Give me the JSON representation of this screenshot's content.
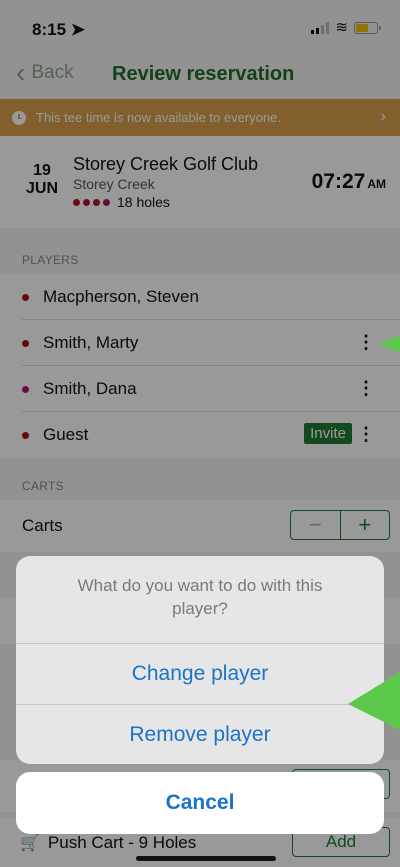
{
  "status_bar": {
    "time": "8:15",
    "location_icon": "location-arrow-icon",
    "signal_icon": "signal-icon",
    "wifi_icon": "wifi-icon",
    "battery_icon": "battery-icon"
  },
  "nav": {
    "back_label": "Back",
    "title": "Review reservation"
  },
  "banner": {
    "text": "This tee time is now available to everyone.",
    "icon": "clock-icon",
    "color": "#d7a04c"
  },
  "course": {
    "day": "19",
    "month": "JUN",
    "club_name": "Storey Creek Golf Club",
    "course_name": "Storey Creek",
    "holes": "18 holes",
    "tee_time": "07:27",
    "ampm": "AM"
  },
  "players": {
    "header": "PLAYERS",
    "items": [
      {
        "name": "Macpherson, Steven"
      },
      {
        "name": "Smith, Marty"
      },
      {
        "name": "Smith, Dana"
      },
      {
        "name": "Guest",
        "badge": "Invite"
      }
    ]
  },
  "carts": {
    "header": "CARTS",
    "label": "Carts",
    "minus": "−",
    "plus": "+"
  },
  "push_cart": {
    "label": "Push Cart - 9 Holes",
    "add": "Add"
  },
  "action_sheet": {
    "message": "What do you want to do with this player?",
    "options": [
      "Change player",
      "Remove player"
    ],
    "cancel": "Cancel"
  },
  "colors": {
    "accent": "#1e7a34",
    "action_blue": "#1a73c9",
    "pointer": "#5cc94a"
  }
}
